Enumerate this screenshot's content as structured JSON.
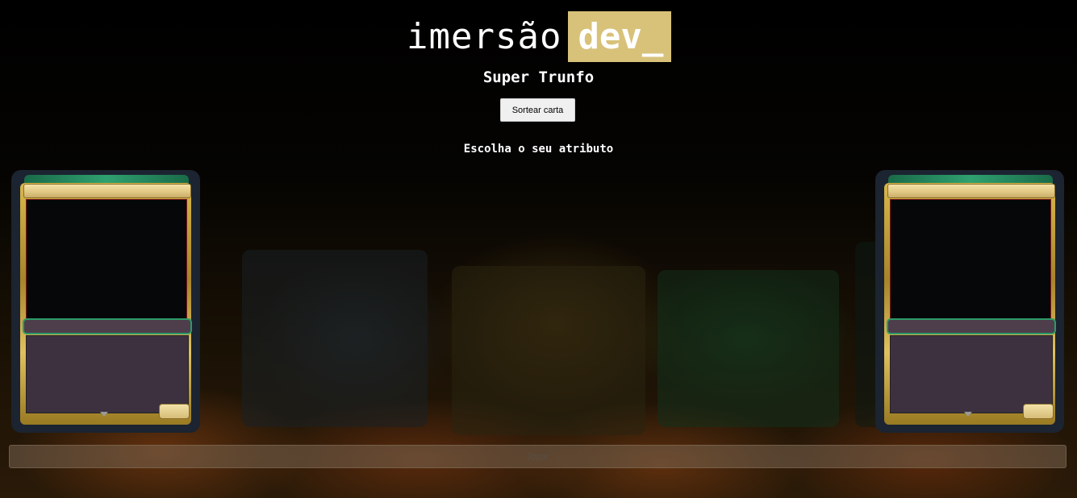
{
  "logo": {
    "text": "imersão",
    "highlight": "dev_",
    "highlight_color": "#d8c27a"
  },
  "header": {
    "title": "Super Trunfo"
  },
  "actions": {
    "draw_label": "Sortear carta",
    "play_label": "Jogar"
  },
  "main": {
    "prompt": "Escolha o seu atributo"
  },
  "colors": {
    "background": "#000000",
    "card_frame_gold": "#d9b84a",
    "card_frame_green": "#2fa070",
    "card_text_box": "#3d3140"
  }
}
